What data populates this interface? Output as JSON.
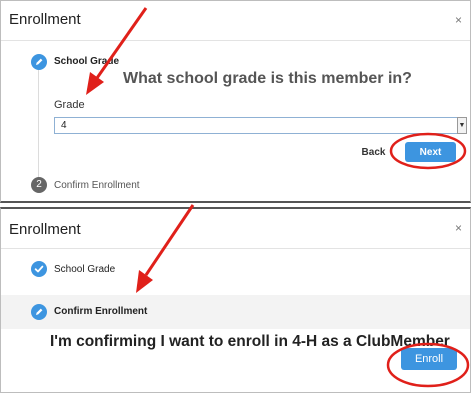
{
  "panel1": {
    "title": "Enrollment",
    "close_glyph": "×",
    "steps": [
      {
        "label": "School Grade",
        "state": "active",
        "icon": "pencil-icon"
      },
      {
        "label": "Confirm Enrollment",
        "state": "pending",
        "number": "2"
      }
    ],
    "question": "What school grade is this member in?",
    "grade_label": "Grade",
    "grade_value": "4",
    "back_label": "Back",
    "next_label": "Next"
  },
  "panel2": {
    "title": "Enrollment",
    "close_glyph": "×",
    "steps": [
      {
        "label": "School Grade",
        "state": "done",
        "icon": "check-icon"
      },
      {
        "label": "Confirm Enrollment",
        "state": "active",
        "icon": "pencil-icon"
      }
    ],
    "confirm_text": "I'm confirming I want to enroll in 4-H as a ClubMember",
    "enroll_label": "Enroll"
  },
  "colors": {
    "accent": "#3d95e0",
    "annotation": "#e0201a",
    "pending_step": "#666666"
  }
}
